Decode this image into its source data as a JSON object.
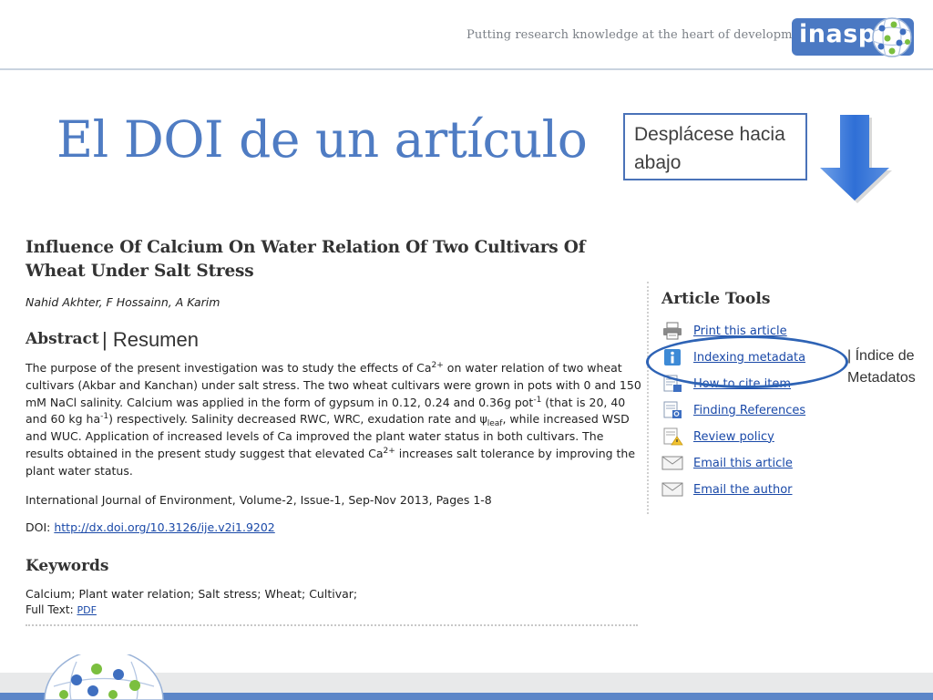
{
  "header": {
    "tagline": "Putting research knowledge at the heart of development",
    "logo_text": "inasp"
  },
  "slide": {
    "title": "El DOI de un artículo",
    "scroll_hint": "Desplácese hacia abajo",
    "resumen_label": "| Resumen",
    "index_callout_line1": "| Índice de",
    "index_callout_line2": "Metadatos",
    "accent_color": "#4f7cc3"
  },
  "article": {
    "title": "Influence Of Calcium On Water Relation Of Two Cultivars Of Wheat Under Salt Stress",
    "authors": "Nahid Akhter, F Hossainn, A Karim",
    "abstract_heading": "Abstract",
    "abstract": {
      "s1": "The purpose of the present investigation was to study the effects of Ca",
      "sup1": "2+",
      "s2": " on water relation of two wheat cultivars (Akbar and Kanchan) under salt stress. The two wheat cultivars were grown in pots with 0 and 150 mM NaCl salinity. Calcium was applied in the form of gypsum in 0.12, 0.24 and 0.36g pot",
      "sup2": "-1",
      "s3": " (that is 20, 40 and 60 kg ha",
      "sup3": "-1",
      "s4": ") respectively. Salinity decreased RWC, WRC, exudation rate and ψ",
      "sub1": "leaf",
      "s5": ", while increased WSD and WUC. Application of increased levels of Ca improved the plant water status in both cultivars. The results obtained in the present study suggest that elevated Ca",
      "sup4": "2+",
      "s6": " increases salt tolerance by improving the plant water status."
    },
    "journal": "International Journal of Environment, Volume-2, Issue-1, Sep-Nov 2013, Pages 1-8",
    "doi_label": "DOI: ",
    "doi_link": "http://dx.doi.org/10.3126/ije.v2i1.9202",
    "keywords_heading": "Keywords",
    "keywords": "Calcium; Plant water relation; Salt stress; Wheat; Cultivar;",
    "fulltext_label": "Full Text: ",
    "fulltext_link": "PDF"
  },
  "tools": {
    "heading": "Article Tools",
    "items": [
      {
        "label": "Print this article",
        "icon": "printer-icon"
      },
      {
        "label": "Indexing metadata",
        "icon": "info-icon"
      },
      {
        "label": "How to cite item",
        "icon": "cite-icon"
      },
      {
        "label": "Finding References",
        "icon": "search-doc-icon"
      },
      {
        "label": "Review policy",
        "icon": "warning-doc-icon"
      },
      {
        "label": "Email this article",
        "icon": "envelope-icon"
      },
      {
        "label": "Email the author",
        "icon": "envelope-icon"
      }
    ]
  }
}
